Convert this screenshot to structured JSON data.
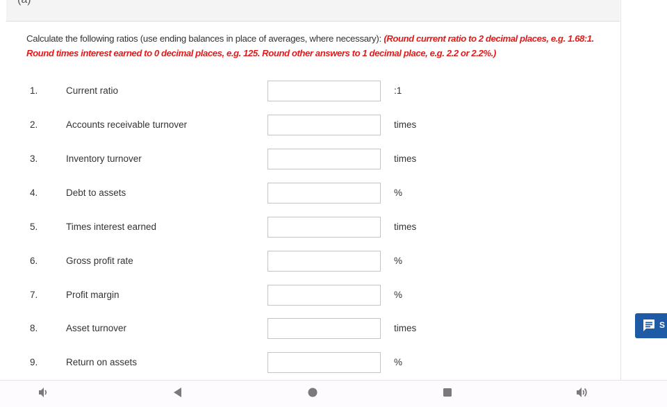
{
  "header": {
    "part_label": "(a)"
  },
  "instructions": {
    "plain": "Calculate the following ratios (use ending balances in place of averages, where necessary): ",
    "emphasis": "(Round current ratio to 2 decimal places, e.g. 1.68:1. Round times interest earned to 0 decimal places, e.g. 125. Round other answers to 1 decimal place, e.g. 2.2 or 2.2%.)"
  },
  "ratios": [
    {
      "number": "1.",
      "label": "Current ratio",
      "value": "",
      "unit": ":1"
    },
    {
      "number": "2.",
      "label": "Accounts receivable turnover",
      "value": "",
      "unit": "times"
    },
    {
      "number": "3.",
      "label": "Inventory turnover",
      "value": "",
      "unit": "times"
    },
    {
      "number": "4.",
      "label": "Debt to assets",
      "value": "",
      "unit": "%"
    },
    {
      "number": "5.",
      "label": "Times interest earned",
      "value": "",
      "unit": "times"
    },
    {
      "number": "6.",
      "label": "Gross profit rate",
      "value": "",
      "unit": "%"
    },
    {
      "number": "7.",
      "label": "Profit margin",
      "value": "",
      "unit": "%"
    },
    {
      "number": "8.",
      "label": "Asset turnover",
      "value": "",
      "unit": "times"
    },
    {
      "number": "9.",
      "label": "Return on assets",
      "value": "",
      "unit": "%"
    }
  ],
  "chat_button": {
    "label": "S",
    "icon": "chat-icon"
  },
  "nav_bar": {
    "icons": [
      "volume-down-icon",
      "back-icon",
      "home-icon",
      "recents-icon",
      "volume-up-icon"
    ]
  },
  "colors": {
    "emphasis_red": "#e21a1a",
    "chat_blue": "#1f5aa6",
    "header_bg": "#f4f4f4",
    "nav_icon_gray": "#7a7a7a"
  }
}
